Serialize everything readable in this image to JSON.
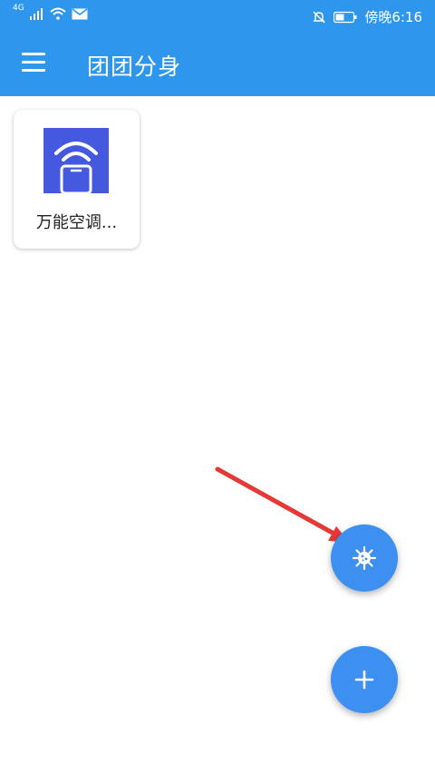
{
  "status_bar": {
    "network_label": "4G",
    "time": "傍晚6:16"
  },
  "app_bar": {
    "title": "团团分身"
  },
  "apps": [
    {
      "label": "万能空调..."
    }
  ],
  "colors": {
    "primary": "#2f96ee",
    "fab": "#3d8ff0",
    "app_icon_bg": "#4559e0",
    "arrow": "#e53935"
  },
  "icons": {
    "menu": "hamburger-menu-icon",
    "fab_top": "virus-icon",
    "fab_bottom": "plus-icon"
  }
}
